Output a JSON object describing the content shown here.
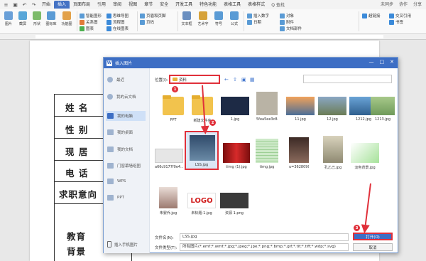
{
  "ribbon": {
    "menu_left": [
      "≡",
      "▣",
      "↶",
      "↷"
    ],
    "tabs": [
      "开始",
      "插入",
      "页面布局",
      "引用",
      "审阅",
      "视图",
      "章节",
      "安全",
      "开发工具",
      "特色功能",
      "表格工具",
      "表格样式"
    ],
    "active_tab": "插入",
    "search_icon_glyph": "Q",
    "search_label": "查找",
    "right_items": [
      "未同步",
      "协作",
      "分享"
    ],
    "big_buttons": [
      "图片",
      "截屏",
      "形状",
      "图标库",
      "功能图"
    ],
    "chart_group": [
      "智能图形",
      "关系图",
      "图表"
    ],
    "online_group": [
      "思维导图",
      "流程图",
      "在线图表"
    ],
    "page_items": [
      "页眉和页脚",
      "页码"
    ],
    "text_items": [
      "文本框",
      "艺术字",
      "符号",
      "公式"
    ],
    "insert_items": [
      "插入数字",
      "对象",
      "日期",
      "附件",
      "文档部件"
    ],
    "right_small": [
      "超链接",
      "交叉引用",
      "书签"
    ]
  },
  "document": {
    "labels": [
      "姓 名",
      "性 别",
      "现 居",
      "电 话",
      "求职意向",
      "教育",
      "背景"
    ]
  },
  "dialog": {
    "title": "插入图片",
    "title_logo": "W",
    "window_controls": [
      "—",
      "□",
      "✕"
    ],
    "sidebar": [
      {
        "label": "最近",
        "active": false
      },
      {
        "label": "我的云文档",
        "active": false
      },
      {
        "label": "我的电脑",
        "active": true
      },
      {
        "label": "我的桌面",
        "active": false
      },
      {
        "label": "我的文档",
        "active": false
      },
      {
        "label": "门窗幕墙组图",
        "active": false
      },
      {
        "label": "WPS",
        "active": false
      },
      {
        "label": "PPT",
        "active": false
      }
    ],
    "location_label": "位置(I):",
    "location_value": "资料",
    "files": [
      {
        "name": "PPT",
        "type": "folder"
      },
      {
        "name": "新建文件夹",
        "type": "folder"
      },
      {
        "name": "1.jpg",
        "type": "image",
        "color": "#1d2a45"
      },
      {
        "name": "5fea5ee3c8e...",
        "type": "image",
        "color": "#b9b3a5"
      },
      {
        "name": "11.jpg",
        "type": "image",
        "color": "#5d7a9e"
      },
      {
        "name": "12.jpg",
        "type": "image",
        "color": "#7a8fa8"
      },
      {
        "name": "1212.jpg",
        "type": "image",
        "color": "#4b86b8"
      },
      {
        "name": "1213.jpg",
        "type": "image",
        "color": "#7ba36a"
      },
      {
        "name": "a66c9177f0e4...",
        "type": "image",
        "color": "#dcdcdc"
      },
      {
        "name": "LSS.jpg",
        "type": "image",
        "color": "#4a6b8a"
      },
      {
        "name": "timg (1).jpg",
        "type": "image",
        "color": "#9e1a1a"
      },
      {
        "name": "timg.jpg",
        "type": "image",
        "color": "#9ecf9e"
      },
      {
        "name": "u=3628090063...",
        "type": "image",
        "color": "#6e4f45"
      },
      {
        "name": "孔乙己.jpg",
        "type": "image",
        "color": "#b8b29a"
      },
      {
        "name": "淡色背景.jpg",
        "type": "image",
        "color": "#cfeec8"
      },
      {
        "name": "朱婴乔.jpg",
        "type": "image",
        "color": "#d8c0b8"
      },
      {
        "name": "未标题-1.jpg",
        "type": "image",
        "color": "#ffffff",
        "text": "LOGO"
      },
      {
        "name": "资源 1.png",
        "type": "image",
        "color": "#3a3a3a"
      }
    ],
    "filename_label": "文件名(N):",
    "filename_value": "LSS.jpg",
    "filetype_label": "文件类型(T):",
    "filetype_value": "所有图片(*.emf;*.wmf;*.jpg;*.jpeg;*.jpe;*.png;*.bmp;*.gif;*.tif;*.tiff;*.wdp;*.svg)",
    "open_button": "打开(O)",
    "cancel_button": "取消",
    "mobile_link": "插入手机图片",
    "callouts": [
      "1",
      "2",
      "3"
    ]
  }
}
